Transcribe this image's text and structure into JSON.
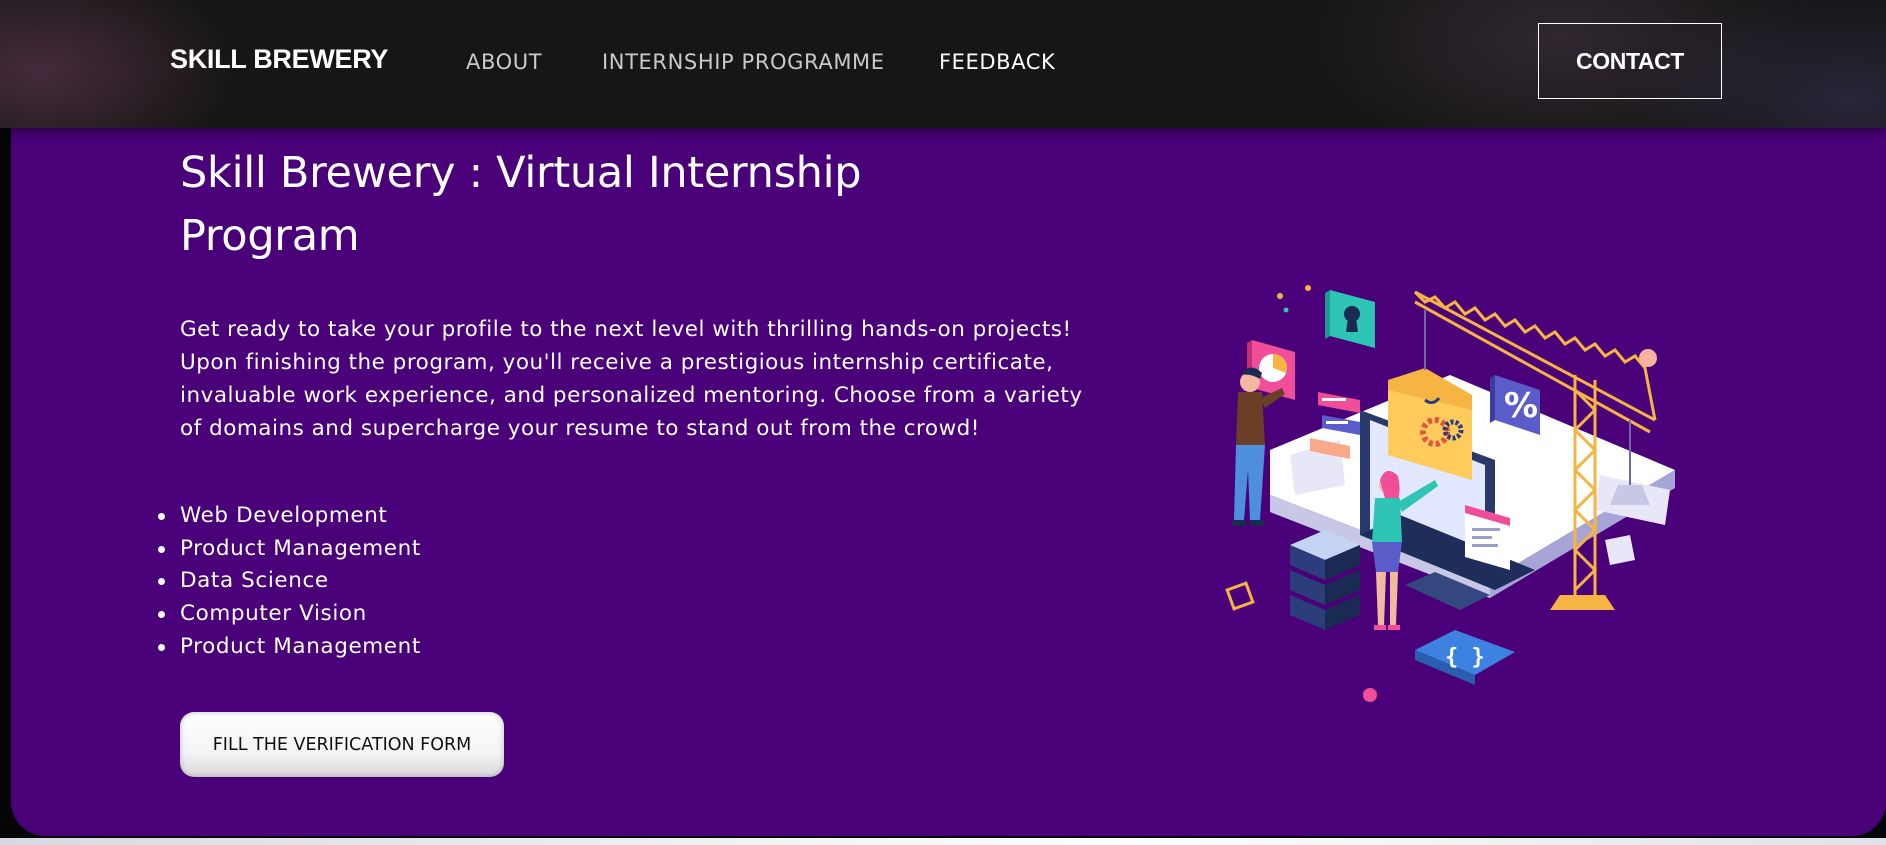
{
  "navbar": {
    "brand": "SKILL BREWERY",
    "links": [
      "ABOUT",
      "INTERNSHIP PROGRAMME",
      "FEEDBACK"
    ],
    "contact_label": "CONTACT"
  },
  "hero": {
    "title": "Skill Brewery : Virtual Internship Program",
    "description": "Get ready to take your profile to the next level with thrilling hands-on projects! Upon finishing the program, you'll receive a prestigious internship certificate, invaluable work experience, and personalized mentoring. Choose from a variety of domains and supercharge your resume to stand out from the crowd!",
    "domains": [
      "Web Development",
      "Product Management",
      "Data Science",
      "Computer Vision",
      "Product Management"
    ],
    "cta_label": "FILL THE VERIFICATION FORM",
    "illustration_icon": "isometric-tech-team-illustration",
    "percent_symbol": "%",
    "braces_symbol": "{ }"
  },
  "colors": {
    "hero_background": "#4a0079",
    "navbar_background": "#161616",
    "accent_yellow": "#f5b547",
    "accent_pink": "#f04e98",
    "accent_teal": "#2ec4b6"
  }
}
